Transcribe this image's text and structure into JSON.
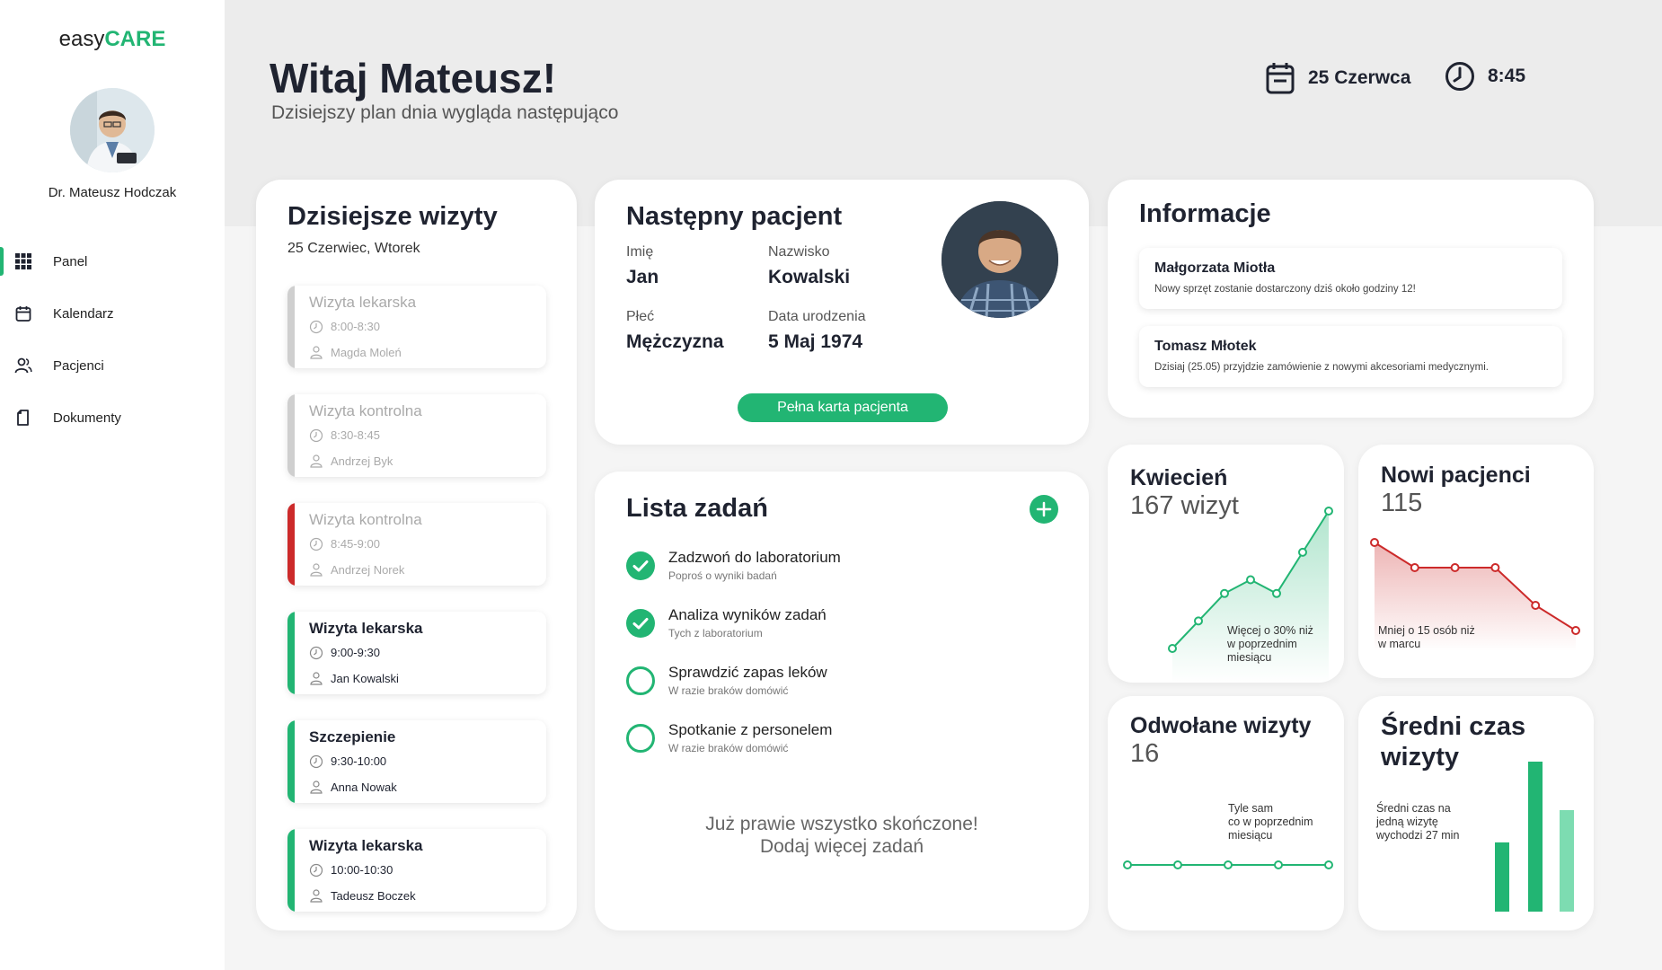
{
  "colors": {
    "accent": "#22b573",
    "danger": "#cc2a2a",
    "muted": "#cccccc"
  },
  "app": {
    "logo_plain": "easy",
    "logo_accent": "CARE"
  },
  "user": {
    "name": "Dr. Mateusz Hodczak"
  },
  "sidebar": {
    "items": [
      {
        "label": "Panel",
        "icon": "grid-icon",
        "active": true
      },
      {
        "label": "Kalendarz",
        "icon": "calendar-icon"
      },
      {
        "label": "Pacjenci",
        "icon": "users-icon"
      },
      {
        "label": "Dokumenty",
        "icon": "document-icon"
      }
    ]
  },
  "header": {
    "greeting": "Witaj Mateusz!",
    "subtitle": "Dzisiejszy plan dnia wygląda następująco",
    "date": "25 Czerwca",
    "time": "8:45"
  },
  "visits": {
    "title": "Dzisiejsze wizyty",
    "date": "25 Czerwiec, Wtorek",
    "items": [
      {
        "title": "Wizyta lekarska",
        "time": "8:00-8:30",
        "person": "Magda Moleń",
        "status": "past"
      },
      {
        "title": "Wizyta kontrolna",
        "time": "8:30-8:45",
        "person": "Andrzej Byk",
        "status": "past"
      },
      {
        "title": "Wizyta kontrolna",
        "time": "8:45-9:00",
        "person": "Andrzej Norek",
        "status": "missed"
      },
      {
        "title": "Wizyta lekarska",
        "time": "9:00-9:30",
        "person": "Jan Kowalski",
        "status": "upcoming"
      },
      {
        "title": "Szczepienie",
        "time": "9:30-10:00",
        "person": "Anna Nowak",
        "status": "upcoming"
      },
      {
        "title": "Wizyta lekarska",
        "time": "10:00-10:30",
        "person": "Tadeusz Boczek",
        "status": "upcoming"
      }
    ]
  },
  "next_patient": {
    "title": "Następny pacjent",
    "first_name_label": "Imię",
    "first_name": "Jan",
    "last_name_label": "Nazwisko",
    "last_name": "Kowalski",
    "sex_label": "Płeć",
    "sex": "Mężczyzna",
    "birth_label": "Data urodzenia",
    "birth": "5 Maj 1974",
    "button": "Pełna karta pacjenta"
  },
  "tasks": {
    "title": "Lista zadań",
    "items": [
      {
        "title": "Zadzwoń do laboratorium",
        "subtitle": "Poproś o wyniki badań",
        "done": true
      },
      {
        "title": "Analiza wyników zadań",
        "subtitle": "Tych z laboratorium",
        "done": true
      },
      {
        "title": "Sprawdzić zapas leków",
        "subtitle": "W razie braków domówić",
        "done": false
      },
      {
        "title": "Spotkanie z personelem",
        "subtitle": "W razie braków domówić",
        "done": false
      }
    ],
    "footer_line1": "Już prawie wszystko skończone!",
    "footer_line2": "Dodaj więcej zadań"
  },
  "info": {
    "title": "Informacje",
    "messages": [
      {
        "name": "Małgorzata Miotła",
        "text": "Nowy sprzęt zostanie dostarczony dziś około godziny 12!"
      },
      {
        "name": "Tomasz Młotek",
        "text": "Dzisiaj (25.05) przyjdzie zamówienie z nowymi akcesoriami medycznymi."
      }
    ]
  },
  "stats": {
    "april": {
      "title": "Kwiecień",
      "value": "167 wizyt",
      "note_l1": "Więcej o 30% niż",
      "note_l2": "w poprzednim",
      "note_l3": "miesiącu"
    },
    "new_patients": {
      "title": "Nowi pacjenci",
      "value": "115",
      "note_l1": "Mniej o 15 osób niż",
      "note_l2": "w marcu"
    },
    "cancelled": {
      "title": "Odwołane wizyty",
      "value": "16",
      "note_l1": "Tyle sam",
      "note_l2": "co w poprzednim",
      "note_l3": "miesiącu"
    },
    "avg_time": {
      "title_l1": "Średni czas",
      "title_l2": "wizyty",
      "note_l1": "Średni czas na",
      "note_l2": "jedną wizytę",
      "note_l3": "wychodzi 27 min"
    }
  },
  "chart_data": [
    {
      "type": "area",
      "series": [
        {
          "values": [
            2,
            4,
            6,
            7,
            6,
            9,
            12
          ]
        }
      ],
      "color": "#22b573"
    },
    {
      "type": "area",
      "series": [
        {
          "values": [
            10,
            8,
            8,
            8,
            5,
            3
          ]
        }
      ],
      "color": "#cc2a2a"
    },
    {
      "type": "line",
      "series": [
        {
          "values": [
            5,
            5,
            5,
            5,
            5
          ]
        }
      ],
      "color": "#22b573"
    },
    {
      "type": "bar",
      "series": [
        {
          "values": [
            30,
            65,
            44
          ]
        }
      ],
      "colors": [
        "#22b573",
        "#22b573",
        "#7ddcb1"
      ]
    }
  ]
}
